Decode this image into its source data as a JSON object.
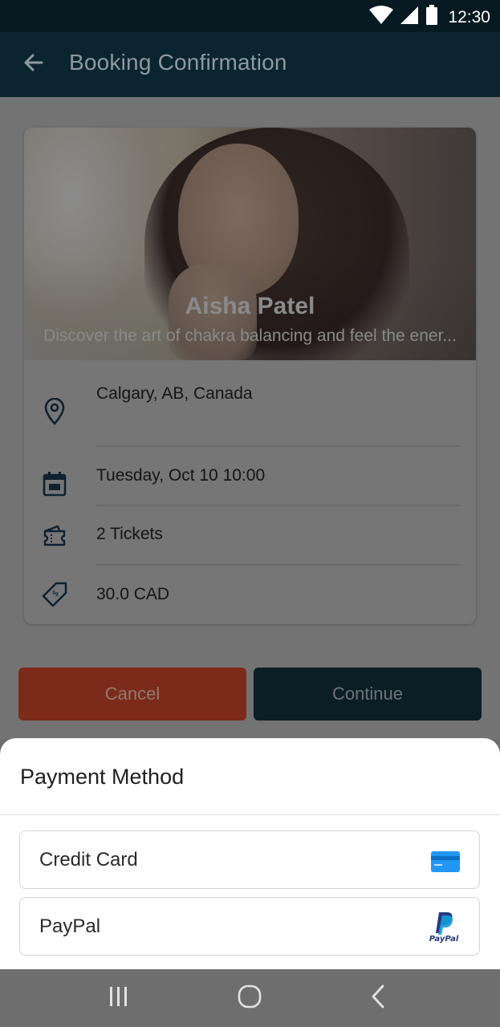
{
  "status_bar": {
    "time": "12:30",
    "icons": [
      "wifi-icon",
      "signal-icon",
      "battery-icon"
    ]
  },
  "app_bar": {
    "title": "Booking Confirmation",
    "back_icon": "arrow-left-icon"
  },
  "event": {
    "name": "Aisha Patel",
    "description": "Discover the art of chakra balancing and feel the ener...",
    "details": [
      {
        "icon": "location-pin-icon",
        "text": "Calgary, AB, Canada"
      },
      {
        "icon": "calendar-icon",
        "text": "Tuesday, Oct 10 10:00"
      },
      {
        "icon": "ticket-icon",
        "text": "2 Tickets"
      },
      {
        "icon": "price-tag-icon",
        "text": "30.0 CAD"
      }
    ]
  },
  "actions": {
    "cancel_label": "Cancel",
    "continue_label": "Continue"
  },
  "payment_sheet": {
    "title": "Payment Method",
    "options": [
      {
        "label": "Credit Card",
        "icon": "credit-card-icon"
      },
      {
        "label": "PayPal",
        "icon": "paypal-icon",
        "brand_text": "PayPal"
      }
    ]
  },
  "nav_bar": {
    "icons": [
      "recents-icon",
      "home-icon",
      "back-icon"
    ]
  },
  "colors": {
    "app_bar": "#0b2530",
    "cancel": "#7c2a1a",
    "continue": "#0b1e26",
    "card_icon_blue": "#2196f3",
    "paypal_dark": "#253b80",
    "paypal_light": "#179bd7"
  }
}
